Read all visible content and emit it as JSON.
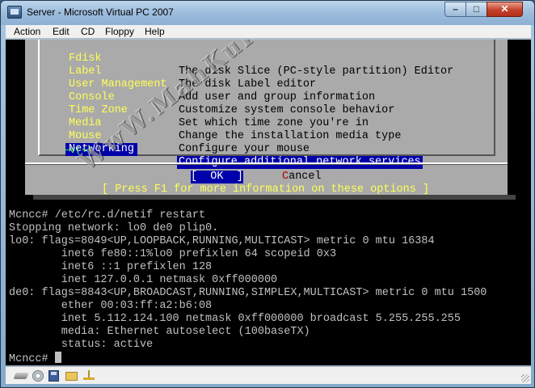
{
  "window": {
    "title": "Server - Microsoft Virtual PC 2007"
  },
  "menubar": [
    "Action",
    "Edit",
    "CD",
    "Floppy",
    "Help"
  ],
  "dialog": {
    "items": [
      {
        "key": "Fdisk",
        "desc": "The disk Slice (PC-style partition) Editor"
      },
      {
        "key": "Label",
        "desc": "The disk Label editor"
      },
      {
        "key": "User Management",
        "desc": "Add user and group information"
      },
      {
        "key": "Console",
        "desc": "Customize system console behavior"
      },
      {
        "key": "Time Zone",
        "desc": "Set which time zone you're in"
      },
      {
        "key": "Media",
        "desc": "Change the installation media type"
      },
      {
        "key": "Mouse",
        "desc": "Configure your mouse"
      },
      {
        "key": "Networking",
        "desc": "Configure additional network services",
        "selected": true
      }
    ],
    "more_indicator": "─v(+)",
    "ok_label": "[  OK  ]",
    "cancel_hotkey": "C",
    "cancel_rest": "ancel",
    "help_text": "[ Press F1 for more information on these options ]"
  },
  "console": {
    "lines": [
      "Mcncc# /etc/rc.d/netif restart",
      "Stopping network: lo0 de0 plip0.",
      "lo0: flags=8049<UP,LOOPBACK,RUNNING,MULTICAST> metric 0 mtu 16384",
      "        inet6 fe80::1%lo0 prefixlen 64 scopeid 0x3",
      "        inet6 ::1 prefixlen 128",
      "        inet 127.0.0.1 netmask 0xff000000",
      "de0: flags=8843<UP,BROADCAST,RUNNING,SIMPLEX,MULTICAST> metric 0 mtu 1500",
      "        ether 00:03:ff:a2:b6:08",
      "        inet 5.112.124.100 netmask 0xff000000 broadcast 5.255.255.255",
      "        media: Ethernet autoselect (100baseTX)",
      "        status: active"
    ],
    "prompt": "Mcncc# "
  },
  "watermark": "WwW.MahKuR.BloGSpoT.CoM",
  "statusbar": {
    "icons": [
      "hard-disk-icon",
      "cd-icon",
      "floppy-icon",
      "shared-folder-icon",
      "network-icon"
    ]
  },
  "colors": {
    "menu_key": "#ffff55",
    "selection_bg": "#0000aa",
    "dialog_bg": "#aaaaaa",
    "console_text": "#c0c0c0"
  }
}
